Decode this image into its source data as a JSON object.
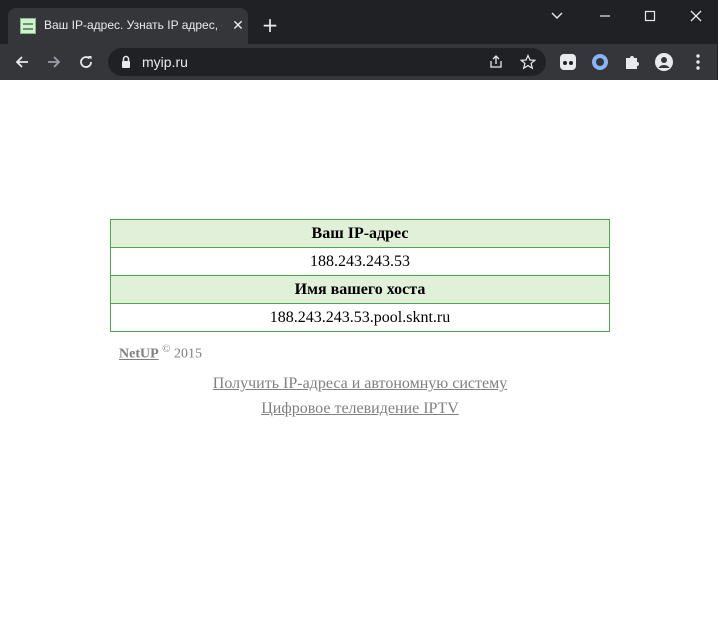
{
  "browser": {
    "tab_title": "Ваш IP-адрес. Узнать IP адрес, о",
    "url": "myip.ru",
    "tab_close_glyph": "✕",
    "new_tab_glyph": "+"
  },
  "page": {
    "ip_heading": "Ваш IP-адрес",
    "ip_value": "188.243.243.53",
    "host_heading": "Имя вашего хоста",
    "host_value": "188.243.243.53.pool.sknt.ru",
    "footer": {
      "brand": "NetUP",
      "copyright": "©",
      "year": "2015"
    },
    "links": [
      "Получить IP-адреса и автономную систему",
      "Цифровое телевидение IPTV"
    ]
  },
  "colors": {
    "chrome_dark": "#202124",
    "chrome_toolbar": "#35363a",
    "table_header_bg": "#e1f0d8",
    "table_border": "#4ca64c",
    "link_gray": "#808080"
  }
}
